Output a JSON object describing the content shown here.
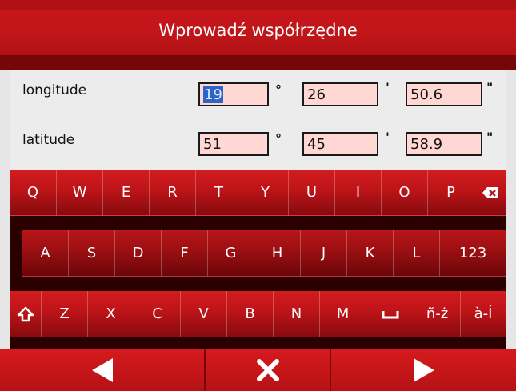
{
  "title": "Wprowadź współrzędne",
  "rows": [
    {
      "label": "longitude",
      "deg": "19",
      "min": "26",
      "sec": "50.6"
    },
    {
      "label": "latitude",
      "deg": "51",
      "min": "45",
      "sec": "58.9"
    }
  ],
  "units": {
    "deg": "°",
    "min": "'",
    "sec": "\""
  },
  "keyboard": {
    "row1": [
      "Q",
      "W",
      "E",
      "R",
      "T",
      "Y",
      "U",
      "I",
      "O",
      "P"
    ],
    "row2": [
      "A",
      "S",
      "D",
      "F",
      "G",
      "H",
      "J",
      "K",
      "L"
    ],
    "row2_extra": "123",
    "row3": [
      "Z",
      "X",
      "C",
      "V",
      "B",
      "N",
      "M"
    ],
    "special_ntilde": "ñ-ż",
    "special_agrave": "à-Í"
  }
}
